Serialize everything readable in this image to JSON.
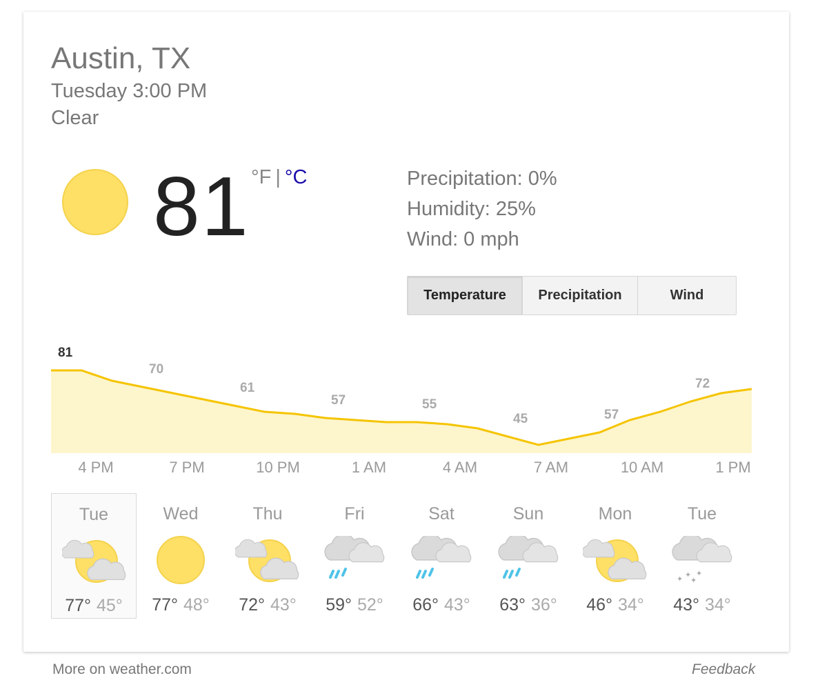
{
  "location": "Austin, TX",
  "datetime": "Tuesday 3:00 PM",
  "condition": "Clear",
  "current": {
    "temp": "81",
    "icon": "sun-icon",
    "unit_f": "°F",
    "unit_sep": "|",
    "unit_c": "°C"
  },
  "details": {
    "precipitation": "Precipitation: 0%",
    "humidity": "Humidity: 25%",
    "wind": "Wind: 0 mph"
  },
  "tabs": [
    {
      "label": "Temperature",
      "selected": true
    },
    {
      "label": "Precipitation",
      "selected": false
    },
    {
      "label": "Wind",
      "selected": false
    }
  ],
  "chart_data": {
    "type": "area",
    "title": "",
    "xlabel": "",
    "ylabel": "",
    "x": [
      "3 PM",
      "4 PM",
      "5 PM",
      "6 PM",
      "7 PM",
      "8 PM",
      "9 PM",
      "10 PM",
      "11 PM",
      "12 AM",
      "1 AM",
      "2 AM",
      "3 AM",
      "4 AM",
      "5 AM",
      "6 AM",
      "7 AM",
      "8 AM",
      "9 AM",
      "10 AM",
      "11 AM",
      "12 PM",
      "1 PM",
      "2 PM"
    ],
    "values": [
      81,
      81,
      76,
      73,
      70,
      67,
      64,
      61,
      60,
      58,
      57,
      56,
      56,
      55,
      53,
      49,
      45,
      48,
      51,
      57,
      61,
      66,
      70,
      72
    ],
    "labeled_points": [
      {
        "x": "3 PM",
        "label": "81"
      },
      {
        "x": "6 PM",
        "label": "70"
      },
      {
        "x": "9 PM",
        "label": "61"
      },
      {
        "x": "12 AM",
        "label": "57"
      },
      {
        "x": "3 AM",
        "label": "55"
      },
      {
        "x": "6 AM",
        "label": "45"
      },
      {
        "x": "9 AM",
        "label": "57"
      },
      {
        "x": "12 PM",
        "label": "72"
      }
    ],
    "tick_labels": [
      "4 PM",
      "7 PM",
      "10 PM",
      "1 AM",
      "4 AM",
      "7 AM",
      "10 AM",
      "1 PM"
    ],
    "line_color": "#f5c400",
    "fill_color": "#fdf5cc",
    "grid": false
  },
  "days": [
    {
      "name": "Tue",
      "icon": "partly-cloudy-icon",
      "hi": "77°",
      "lo": "45°",
      "selected": true
    },
    {
      "name": "Wed",
      "icon": "sun-icon",
      "hi": "77°",
      "lo": "48°",
      "selected": false
    },
    {
      "name": "Thu",
      "icon": "partly-cloudy-icon",
      "hi": "72°",
      "lo": "43°",
      "selected": false
    },
    {
      "name": "Fri",
      "icon": "rain-icon",
      "hi": "59°",
      "lo": "52°",
      "selected": false
    },
    {
      "name": "Sat",
      "icon": "rain-icon",
      "hi": "66°",
      "lo": "43°",
      "selected": false
    },
    {
      "name": "Sun",
      "icon": "rain-icon",
      "hi": "63°",
      "lo": "36°",
      "selected": false
    },
    {
      "name": "Mon",
      "icon": "partly-cloudy-icon",
      "hi": "46°",
      "lo": "34°",
      "selected": false
    },
    {
      "name": "Tue",
      "icon": "snow-icon",
      "hi": "43°",
      "lo": "34°",
      "selected": false
    }
  ],
  "footer": {
    "more_link": "More on weather.com",
    "feedback": "Feedback"
  },
  "colors": {
    "sun": "#ffe066",
    "sun_stroke": "#f4d24c",
    "cloud": "#dcdcdc",
    "rain": "#4fc3e8",
    "link": "#1a0dab"
  }
}
